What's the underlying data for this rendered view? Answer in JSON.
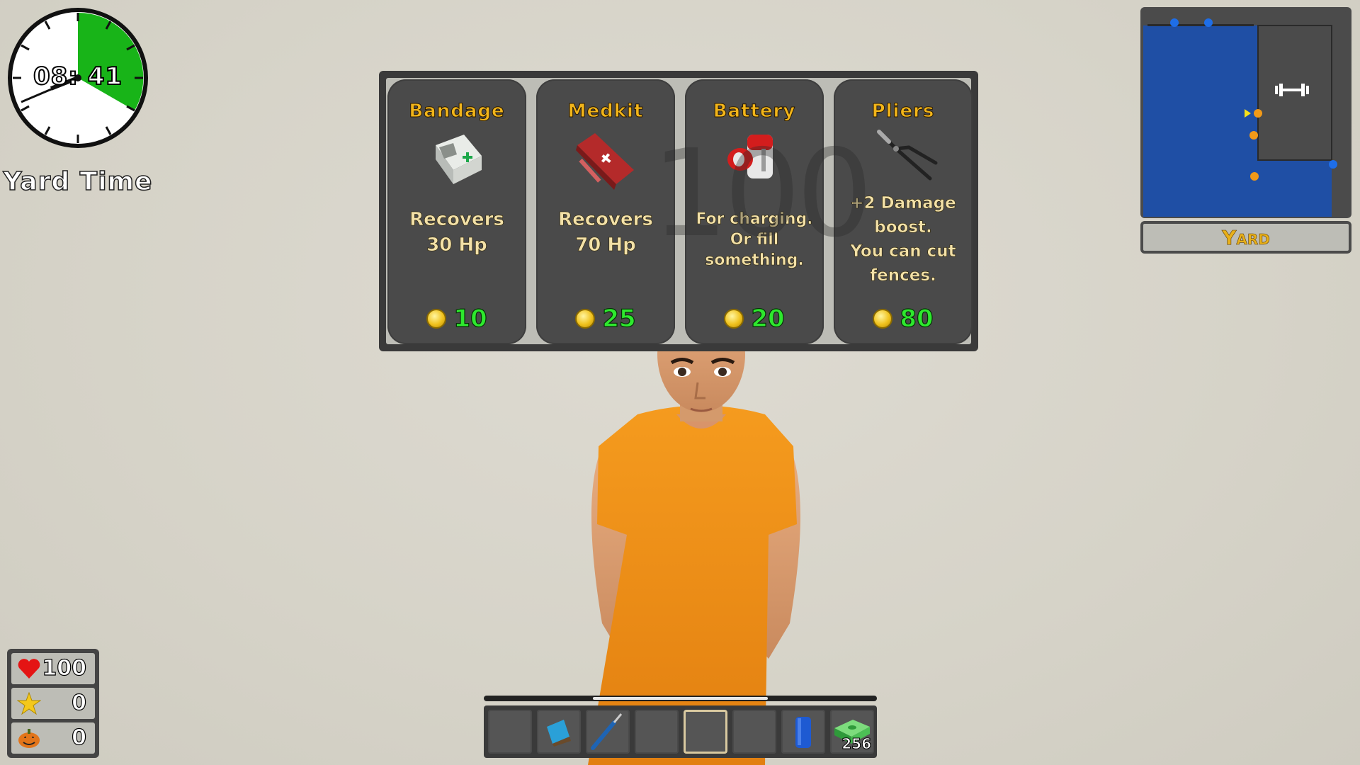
{
  "clock": {
    "time": "08: 41",
    "phase_label": "Yard Time"
  },
  "shop": {
    "items": [
      {
        "name": "Bandage",
        "description": [
          "Recovers",
          "30 Hp"
        ],
        "price": "10",
        "icon": "bandage-icon"
      },
      {
        "name": "Medkit",
        "description": [
          "Recovers",
          "70 Hp"
        ],
        "price": "25",
        "icon": "medkit-icon"
      },
      {
        "name": "Battery",
        "description": [
          "For charging.",
          "Or fill",
          "something."
        ],
        "price": "20",
        "icon": "battery-icon"
      },
      {
        "name": "Pliers",
        "description": [
          "+2 Damage",
          "boost.",
          "You can cut",
          "fences."
        ],
        "price": "80",
        "icon": "pliers-icon"
      }
    ],
    "overlay_number": "100"
  },
  "minimap": {
    "location": "Yard"
  },
  "stats": {
    "health": "100",
    "stars": "0",
    "pumpkins": "0"
  },
  "hotbar": {
    "selected_slot": 5,
    "progress": 0.45,
    "slots": [
      {
        "item": ""
      },
      {
        "item": "book-icon"
      },
      {
        "item": "screwdriver-icon"
      },
      {
        "item": ""
      },
      {
        "item": ""
      },
      {
        "item": ""
      },
      {
        "item": "blue-can-icon"
      },
      {
        "item": "cash-icon",
        "count": "256"
      }
    ]
  },
  "colors": {
    "title_gold": "#f2b51a",
    "price_green": "#2ee82e",
    "map_blue": "#1f4fa5",
    "prison_orange": "#f0921c"
  }
}
